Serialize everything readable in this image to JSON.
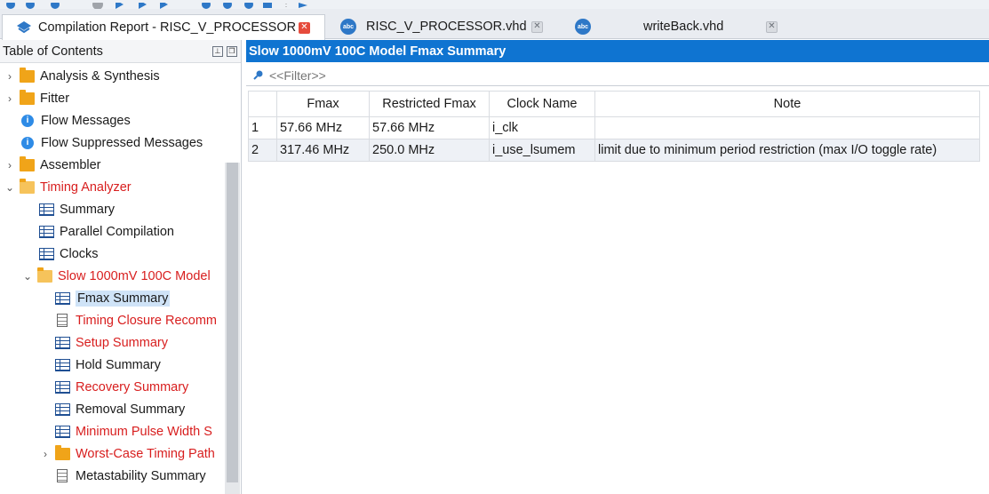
{
  "tabs": [
    {
      "label": "Compilation Report - RISC_V_PROCESSOR",
      "icon": "compilation-report-icon",
      "active": true
    },
    {
      "label": "RISC_V_PROCESSOR.vhd",
      "icon": "abc-file-icon",
      "active": false
    },
    {
      "label": "writeBack.vhd",
      "icon": "abc-file-icon",
      "active": false
    }
  ],
  "toc": {
    "title": "Table of Contents",
    "items": [
      {
        "label": "Analysis & Synthesis",
        "icon": "folder-icon",
        "expand": "collapsed",
        "red": false
      },
      {
        "label": "Fitter",
        "icon": "folder-icon",
        "expand": "collapsed",
        "red": false
      },
      {
        "label": "Flow Messages",
        "icon": "info-icon",
        "expand": "none",
        "red": false
      },
      {
        "label": "Flow Suppressed Messages",
        "icon": "info-icon",
        "expand": "none",
        "red": false
      },
      {
        "label": "Assembler",
        "icon": "folder-icon",
        "expand": "collapsed",
        "red": false
      },
      {
        "label": "Timing Analyzer",
        "icon": "folder-open-icon",
        "expand": "expanded",
        "red": true
      },
      {
        "label": "Summary",
        "icon": "table-icon",
        "expand": "none",
        "red": false
      },
      {
        "label": "Parallel Compilation",
        "icon": "table-icon",
        "expand": "none",
        "red": false
      },
      {
        "label": "Clocks",
        "icon": "table-icon",
        "expand": "none",
        "red": false
      },
      {
        "label": "Slow 1000mV 100C Model",
        "icon": "folder-open-icon",
        "expand": "expanded",
        "red": true
      },
      {
        "label": "Fmax Summary",
        "icon": "table-icon",
        "expand": "none",
        "red": false,
        "selected": true
      },
      {
        "label": "Timing Closure Recomm",
        "icon": "document-icon",
        "expand": "none",
        "red": true
      },
      {
        "label": "Setup Summary",
        "icon": "table-icon",
        "expand": "none",
        "red": true
      },
      {
        "label": "Hold Summary",
        "icon": "table-icon",
        "expand": "none",
        "red": false
      },
      {
        "label": "Recovery Summary",
        "icon": "table-icon",
        "expand": "none",
        "red": true
      },
      {
        "label": "Removal Summary",
        "icon": "table-icon",
        "expand": "none",
        "red": false
      },
      {
        "label": "Minimum Pulse Width S",
        "icon": "table-icon",
        "expand": "none",
        "red": true
      },
      {
        "label": "Worst-Case Timing Path",
        "icon": "folder-icon",
        "expand": "collapsed",
        "red": true
      },
      {
        "label": "Metastability Summary",
        "icon": "document-icon",
        "expand": "none",
        "red": false
      }
    ]
  },
  "report": {
    "title": "Slow 1000mV 100C Model Fmax Summary",
    "filter_placeholder": "<<Filter>>",
    "columns": [
      "",
      "Fmax",
      "Restricted Fmax",
      "Clock Name",
      "Note"
    ],
    "rows": [
      [
        "1",
        "57.66 MHz",
        "57.66 MHz",
        "i_clk",
        ""
      ],
      [
        "2",
        "317.46 MHz",
        "250.0 MHz",
        "i_use_lsumem",
        "limit due to minimum period restriction (max I/O toggle rate)"
      ]
    ]
  }
}
